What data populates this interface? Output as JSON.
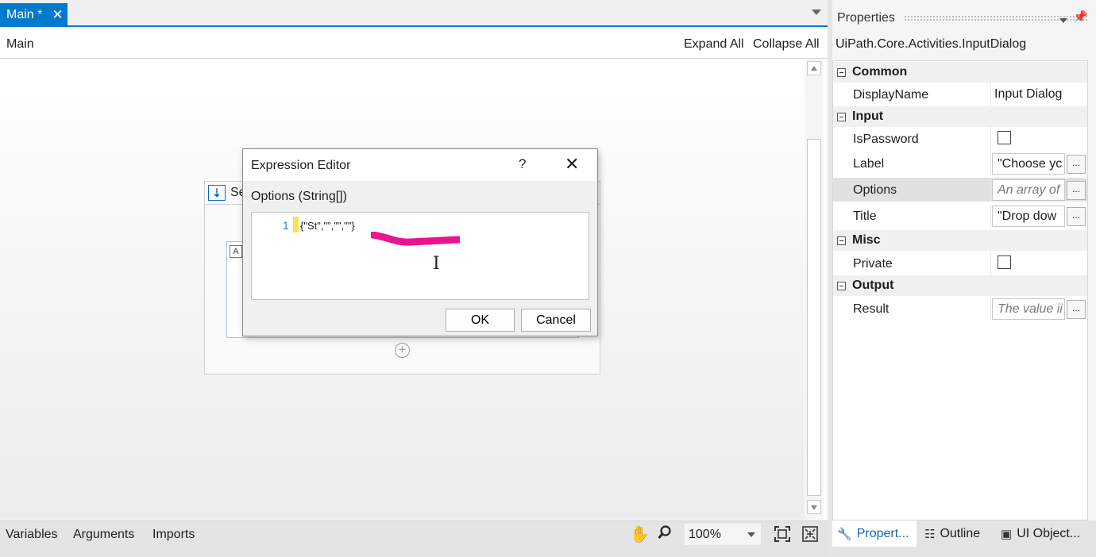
{
  "document_tab": {
    "label": "Main *",
    "close": "✕"
  },
  "designer": {
    "breadcrumb": "Main",
    "expand_all": "Expand All",
    "collapse_all": "Collapse All",
    "sequence_title": "Se",
    "sequence_icon": "sequence-icon"
  },
  "dialog": {
    "title": "Expression Editor",
    "help": "?",
    "close": "✕",
    "field_label": "Options (String[])",
    "line_number": "1",
    "code": "{\"St\",\"\",\"\",\"\"}",
    "ok_label": "OK",
    "cancel_label": "Cancel",
    "annotation_color": "#e8158f"
  },
  "bottom_bar": {
    "variables": "Variables",
    "arguments": "Arguments",
    "imports": "Imports",
    "zoom": "100%"
  },
  "properties": {
    "title": "Properties",
    "type_name": "UiPath.Core.Activities.InputDialog",
    "categories": {
      "common": "Common",
      "input": "Input",
      "misc": "Misc",
      "output": "Output"
    },
    "rows": {
      "display_name": {
        "name": "DisplayName",
        "value": "Input Dialog"
      },
      "is_password": {
        "name": "IsPassword",
        "checked": false
      },
      "label": {
        "name": "Label",
        "value": "\"Choose yc"
      },
      "options": {
        "name": "Options",
        "placeholder": "An array of"
      },
      "title": {
        "name": "Title",
        "value": "\"Drop dow"
      },
      "private": {
        "name": "Private",
        "checked": false
      },
      "result": {
        "name": "Result",
        "placeholder": "The value ii"
      }
    },
    "ellipsis": "..."
  },
  "panel_tabs": {
    "properties": "Propert...",
    "outline": "Outline",
    "ui_objects": "UI Object..."
  },
  "colors": {
    "accent": "#007acc",
    "annotation": "#e8158f"
  }
}
